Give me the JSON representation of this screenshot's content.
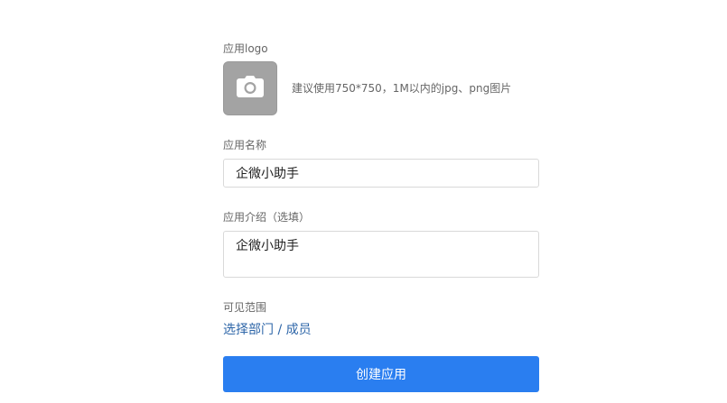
{
  "logo": {
    "label": "应用logo",
    "hint": "建议使用750*750，1M以内的jpg、png图片",
    "upload_icon": "camera-icon",
    "tile_color": "#a3a3a3"
  },
  "name": {
    "label": "应用名称",
    "value": "企微小助手"
  },
  "intro": {
    "label": "应用介绍（选填）",
    "value": "企微小助手"
  },
  "visibility": {
    "label": "可见范围",
    "link": "选择部门 / 成员",
    "link_color": "#2e66a8"
  },
  "submit": {
    "label": "创建应用",
    "color": "#2a7ef0"
  }
}
